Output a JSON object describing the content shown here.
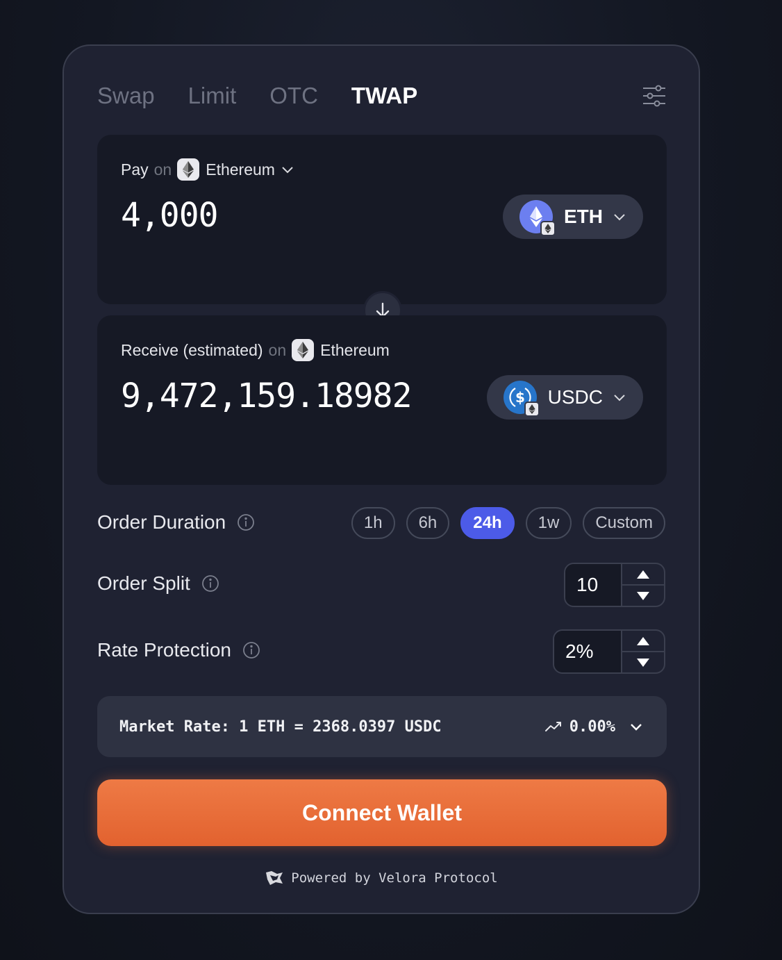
{
  "tabs": [
    {
      "label": "Swap",
      "active": false
    },
    {
      "label": "Limit",
      "active": false
    },
    {
      "label": "OTC",
      "active": false
    },
    {
      "label": "TWAP",
      "active": true
    }
  ],
  "pay": {
    "label": "Pay",
    "on": "on",
    "network": "Ethereum",
    "amount": "4,000",
    "token": "ETH"
  },
  "receive": {
    "label": "Receive (estimated)",
    "on": "on",
    "network": "Ethereum",
    "amount": "9,472,159.18982",
    "token": "USDC"
  },
  "order_duration": {
    "label": "Order Duration",
    "options": [
      "1h",
      "6h",
      "24h",
      "1w",
      "Custom"
    ],
    "selected": "24h"
  },
  "order_split": {
    "label": "Order Split",
    "value": "10"
  },
  "rate_protection": {
    "label": "Rate Protection",
    "value": "2%"
  },
  "market_rate": {
    "text": "Market Rate: 1 ETH = 2368.0397 USDC",
    "change": "0.00%"
  },
  "connect_label": "Connect Wallet",
  "powered_by": "Powered by Velora Protocol",
  "colors": {
    "accent_blue": "#4c5be8",
    "connect_orange": "#e86a35",
    "card_bg": "#1f2232",
    "eth_purple": "#6c7ff0",
    "usdc_blue": "#2775ca"
  }
}
